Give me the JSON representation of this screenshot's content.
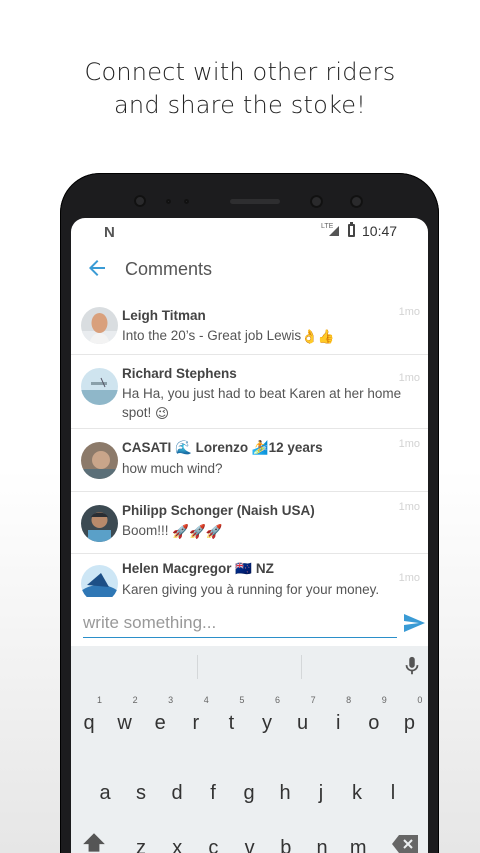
{
  "promo": {
    "line1": "Connect with other riders",
    "line2": "and share the stoke!"
  },
  "status_bar": {
    "notification_glyph": "N",
    "network": "LTE",
    "time": "10:47"
  },
  "app_bar": {
    "title": "Comments",
    "back_icon": "arrow-back-icon"
  },
  "comments": [
    {
      "name": "Leigh Titman",
      "text": "Into the 20’s - Great job Lewis",
      "emoji": "👌👍",
      "time": "1mo"
    },
    {
      "name": "Richard Stephens",
      "text": "Ha Ha, you just had to beat Karen at her home spot!",
      "emoji": "😉",
      "time": "1mo"
    },
    {
      "name": "CASATI",
      "name_emoji1": "🌊",
      "name_mid": " Lorenzo ",
      "name_emoji2": "🏄",
      "name_tail": "12 years",
      "text": "how much wind?",
      "time": "1mo"
    },
    {
      "name": "Philipp Schonger (Naish USA)",
      "text": "Boom!!!",
      "emoji": "🚀🚀🚀",
      "time": "1mo"
    },
    {
      "name": "Helen Macgregor",
      "name_emoji": "🇳🇿",
      "name_tail": " NZ",
      "text": "Karen giving you à running for your money.",
      "time": "1mo"
    }
  ],
  "composer": {
    "placeholder": "write something...",
    "send_icon": "send-icon"
  },
  "keyboard": {
    "row1": [
      {
        "k": "q",
        "n": "1"
      },
      {
        "k": "w",
        "n": "2"
      },
      {
        "k": "e",
        "n": "3"
      },
      {
        "k": "r",
        "n": "4"
      },
      {
        "k": "t",
        "n": "5"
      },
      {
        "k": "y",
        "n": "6"
      },
      {
        "k": "u",
        "n": "7"
      },
      {
        "k": "i",
        "n": "8"
      },
      {
        "k": "o",
        "n": "9"
      },
      {
        "k": "p",
        "n": "0"
      }
    ],
    "row2": [
      "a",
      "s",
      "d",
      "f",
      "g",
      "h",
      "j",
      "k",
      "l"
    ],
    "row3": [
      "z",
      "x",
      "c",
      "v",
      "b",
      "n",
      "m"
    ],
    "mic_icon": "mic-icon",
    "shift_icon": "shift-icon",
    "delete_icon": "backspace-icon"
  }
}
